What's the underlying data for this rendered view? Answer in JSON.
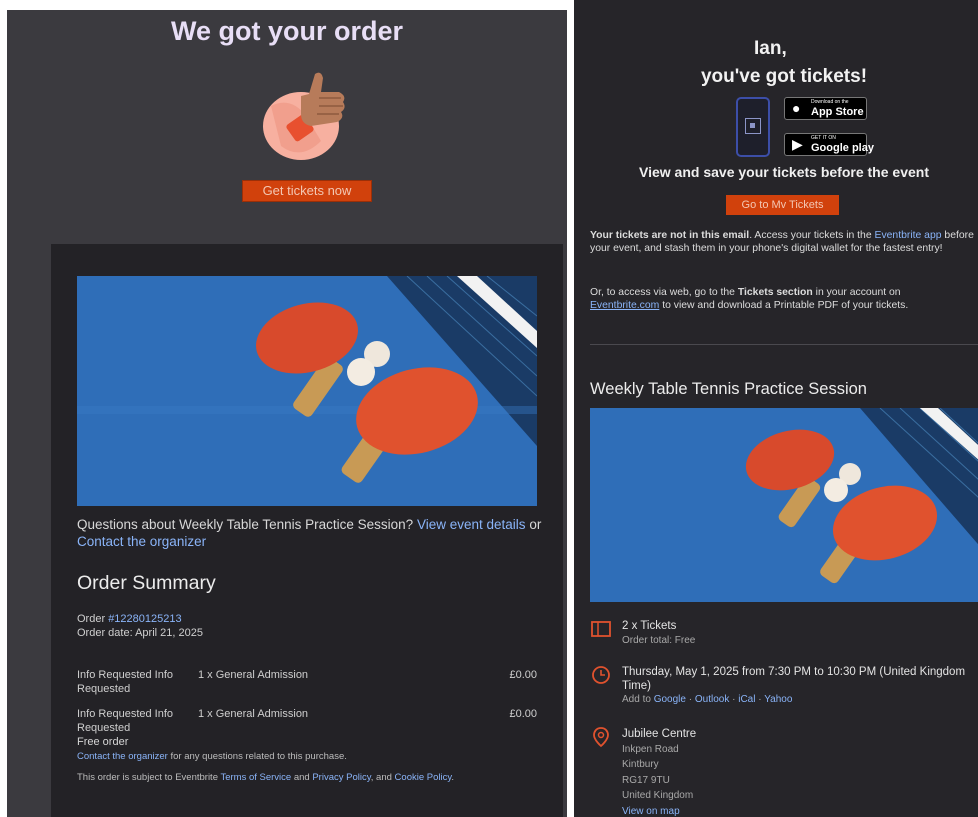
{
  "left": {
    "heading": "We got your order",
    "get_tickets_label": "Get tickets now",
    "questions_prefix": "Questions about Weekly Table Tennis Practice Session?",
    "view_event_details": "View event details",
    "or": "or",
    "contact_organizer": "Contact the organizer",
    "order_summary_title": "Order Summary",
    "order_label": "Order",
    "order_number": "#12280125213",
    "order_date": "Order date: April 21, 2025",
    "rows": [
      {
        "info": "Info Requested Info Requested",
        "ticket": "1 x General Admission",
        "price": "£0.00"
      },
      {
        "info": "Info Requested Info Requested",
        "ticket": "1 x General Admission",
        "price": "£0.00"
      }
    ],
    "free_order": "Free order",
    "contact_link": "Contact the organizer",
    "contact_suffix": "for any questions related to this purchase.",
    "terms_prefix": "This order is subject to Eventbrite",
    "terms_link": "Terms of Service",
    "and": "and",
    "privacy_link": "Privacy Policy",
    "and2": ", and",
    "cookie_link": "Cookie Policy",
    "period": "."
  },
  "right": {
    "greeting_name": "Ian,",
    "greeting_line": "you've got tickets!",
    "app_store": {
      "small": "Download on the",
      "big": "App Store"
    },
    "google_play": {
      "small": "GET IT ON",
      "big": "Google play"
    },
    "view_save": "View and save your tickets before the event",
    "go_to_label": "Go to Mv Tickets",
    "para1_bold": "Your tickets are not in this email",
    "para1_text": ". Access your tickets in the",
    "para1_link": "Eventbrite app",
    "para1_rest": "before your event, and stash them in your phone's digital wallet for the fastest entry!",
    "para2_prefix": "Or, to access via web, go to the",
    "para2_bold": "Tickets section",
    "para2_mid": "in your account on",
    "para2_link": "Eventbrite.com",
    "para2_rest": "to view and download a Printable PDF of your tickets.",
    "event_title": "Weekly Table Tennis Practice Session",
    "tickets_line": "2 x Tickets",
    "order_total": "Order total: Free",
    "date_line1": "Thursday, May 1, 2025 from 7:30 PM to 10:30 PM (United Kingdom",
    "date_line2": "Time)",
    "add_to": "Add to",
    "cal_google": "Google",
    "cal_outlook": "Outlook",
    "cal_ical": "iCal",
    "cal_yahoo": "Yahoo",
    "sep": "·",
    "venue": "Jubilee Centre",
    "address": [
      "Inkpen Road",
      "Kintbury",
      "RG17 9TU",
      "United Kingdom"
    ],
    "view_map": "View on map"
  },
  "colors": {
    "accent": "#d1410c",
    "link": "#8ab4f8",
    "heading": "#e8def6"
  }
}
